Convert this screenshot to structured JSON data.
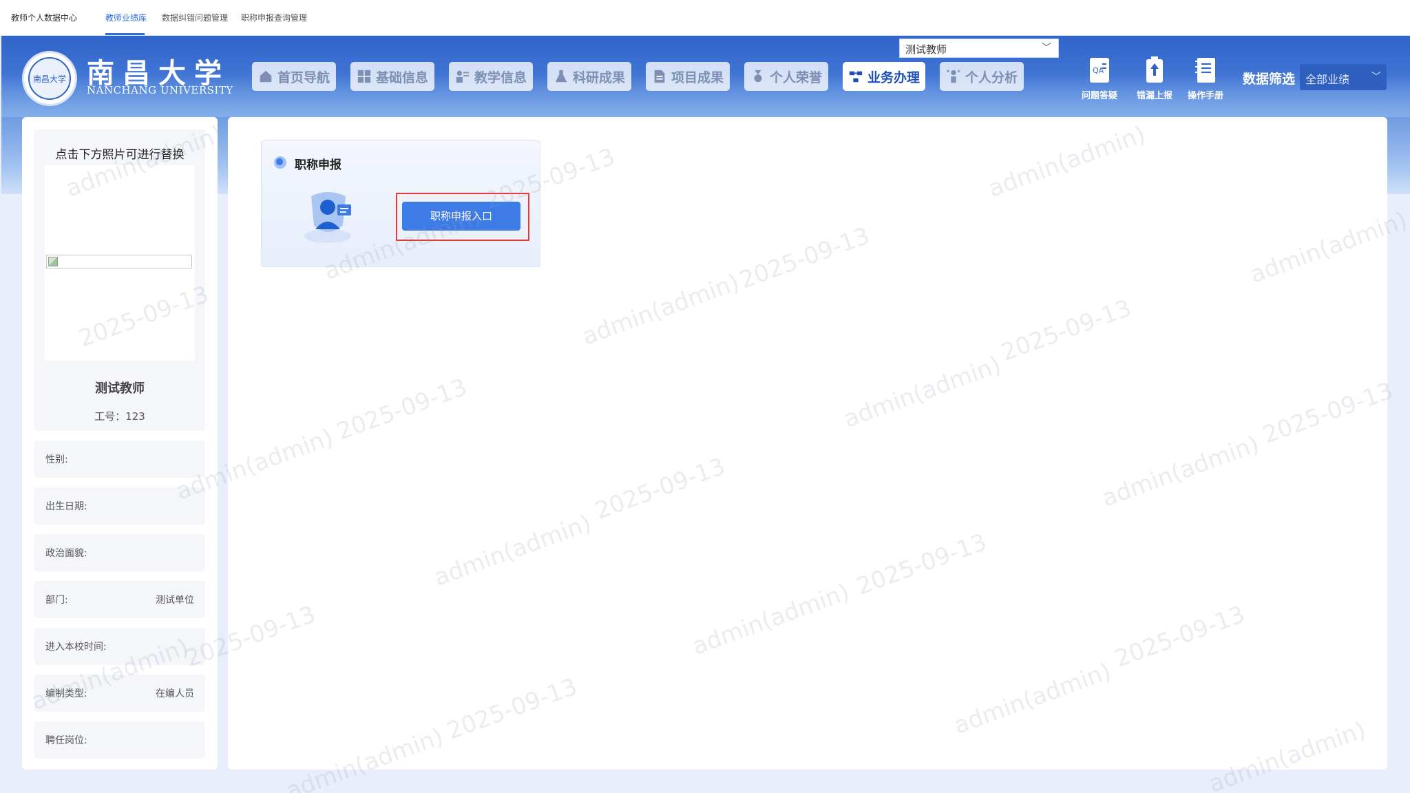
{
  "topbar": {
    "brand": "教师个人数据中心",
    "tabs": [
      {
        "label": "教师业绩库",
        "active": true
      },
      {
        "label": "数据纠错问题管理",
        "active": false
      },
      {
        "label": "职称申报查询管理",
        "active": false
      }
    ]
  },
  "header": {
    "university_cn": "南昌大学",
    "university_en": "NANCHANG UNIVERSITY",
    "logo_text": "南昌大学",
    "teacher_select": "测试教师",
    "nav": [
      {
        "label": "首页导航",
        "icon": "home-icon",
        "active": false
      },
      {
        "label": "基础信息",
        "icon": "grid-icon",
        "active": false
      },
      {
        "label": "教学信息",
        "icon": "teacher-icon",
        "active": false
      },
      {
        "label": "科研成果",
        "icon": "flask-icon",
        "active": false
      },
      {
        "label": "项目成果",
        "icon": "document-icon",
        "active": false
      },
      {
        "label": "个人荣誉",
        "icon": "medal-icon",
        "active": false
      },
      {
        "label": "业务办理",
        "icon": "workflow-icon",
        "active": true
      },
      {
        "label": "个人分析",
        "icon": "analysis-icon",
        "active": false
      }
    ],
    "tools": [
      {
        "label": "问题答疑",
        "icon": "qa-book-icon"
      },
      {
        "label": "错漏上报",
        "icon": "upload-report-icon"
      },
      {
        "label": "操作手册",
        "icon": "manual-icon"
      }
    ],
    "filter_label": "数据筛选",
    "filter_value": "全部业绩"
  },
  "profile": {
    "photo_hint": "点击下方照片可进行替换",
    "name": "测试教师",
    "id_line": "工号：123",
    "fields": [
      {
        "label": "性别:",
        "value": ""
      },
      {
        "label": "出生日期:",
        "value": ""
      },
      {
        "label": "政治面貌:",
        "value": ""
      },
      {
        "label": "部门:",
        "value": "测试单位"
      },
      {
        "label": "进入本校时间:",
        "value": ""
      },
      {
        "label": "编制类型:",
        "value": "在编人员"
      },
      {
        "label": "聘任岗位:",
        "value": ""
      }
    ]
  },
  "card": {
    "title": "职称申报",
    "button": "职称申报入口"
  },
  "watermark": {
    "user": "admin(admin)",
    "date": "2025-09-13"
  },
  "colors": {
    "accent": "#3d7be6",
    "header": "#2f63c8",
    "highlight": "#e53935"
  }
}
